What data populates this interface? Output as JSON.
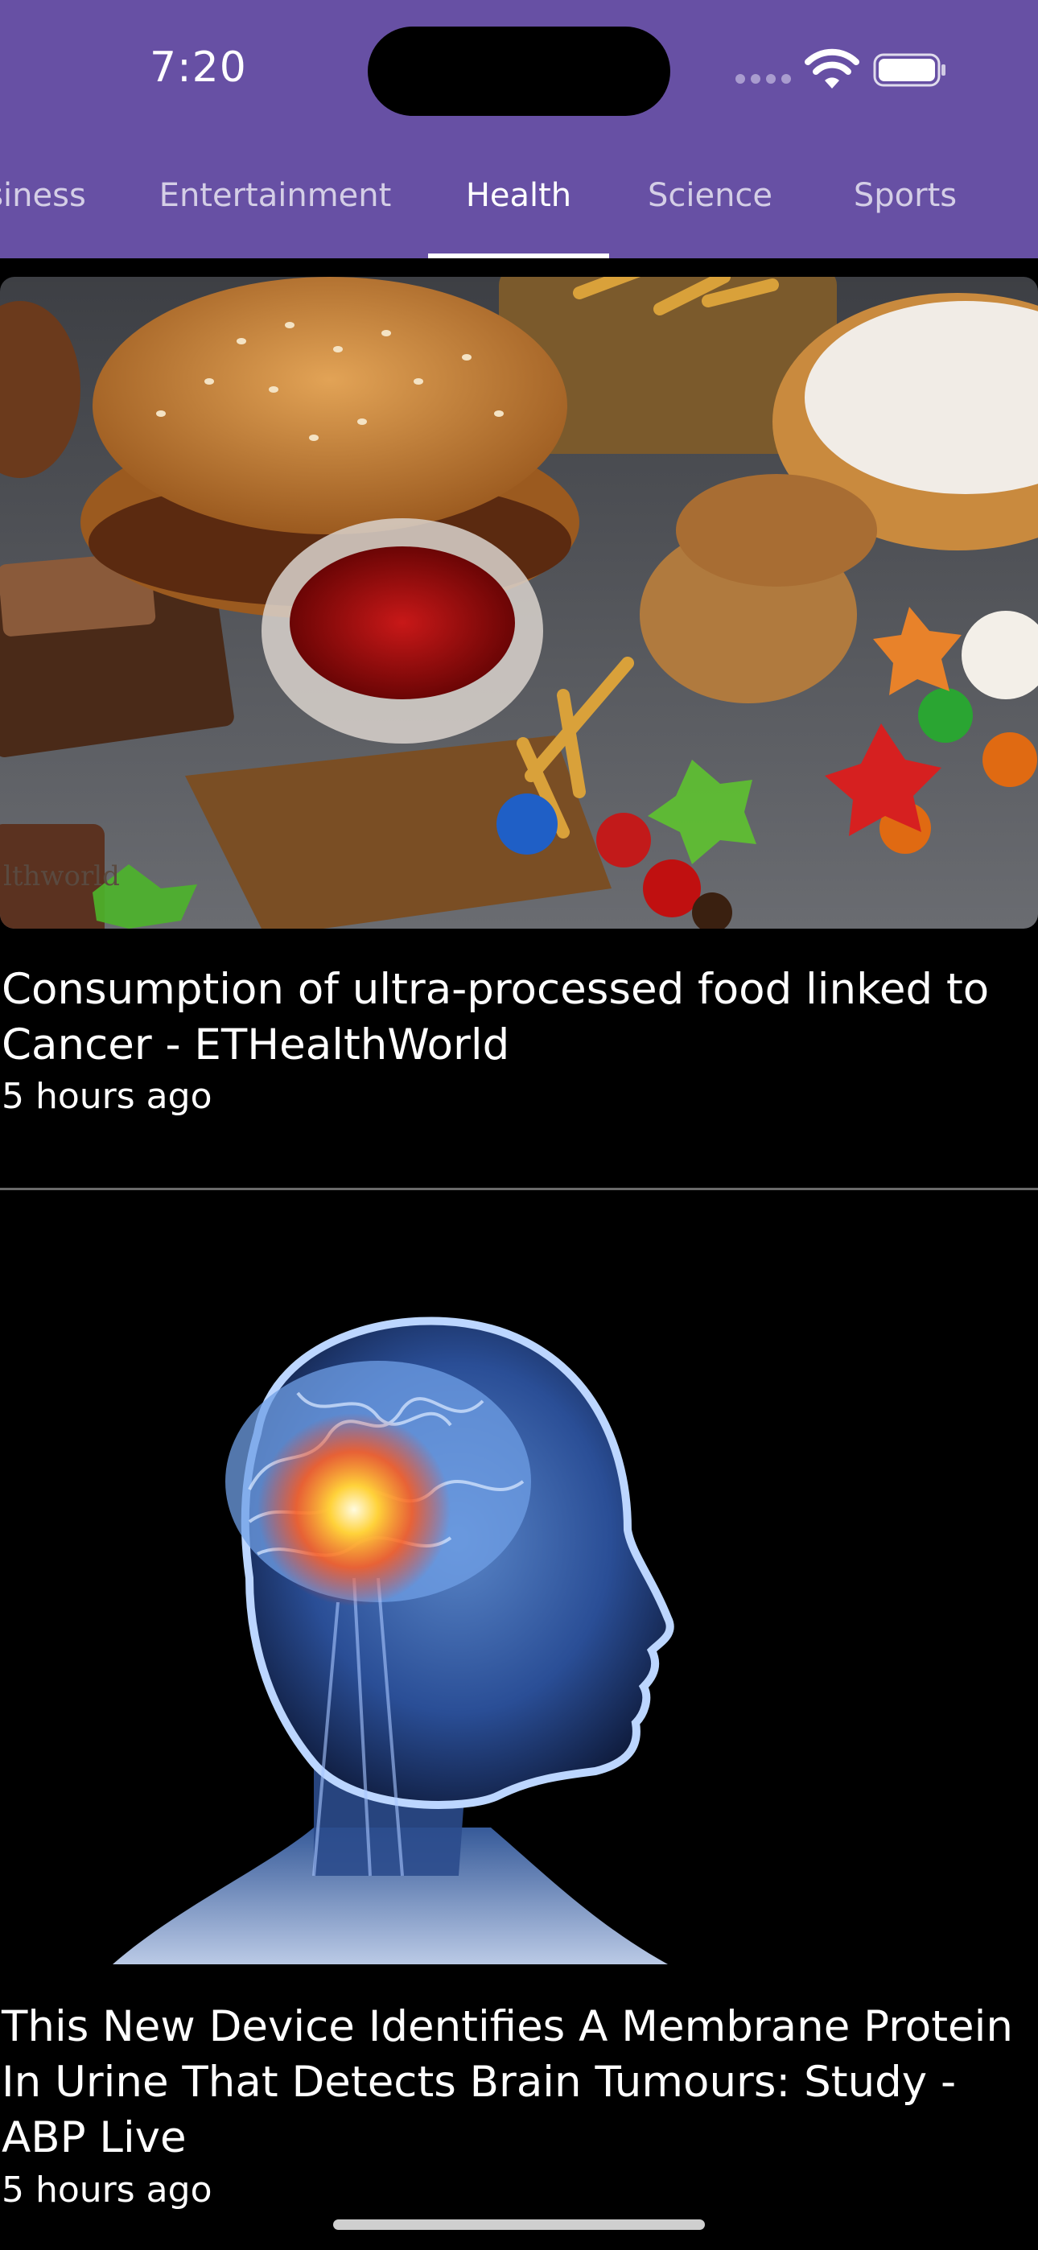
{
  "status_bar": {
    "time": "7:20"
  },
  "tabs": [
    {
      "label": "Business",
      "visible_label": "siness",
      "active": false
    },
    {
      "label": "Entertainment",
      "visible_label": "Entertainment",
      "active": false
    },
    {
      "label": "Health",
      "visible_label": "Health",
      "active": true
    },
    {
      "label": "Science",
      "visible_label": "Science",
      "active": false
    },
    {
      "label": "Sports",
      "visible_label": "Sports",
      "active": false
    }
  ],
  "articles": [
    {
      "title": "Consumption of ultra-processed food linked to Cancer - ETHealthWorld",
      "time": "5 hours ago",
      "image_watermark": "lthworld"
    },
    {
      "title": "This New Device Identifies A Membrane Protein In Urine That Detects Brain Tumours: Study - ABP Live",
      "time": "5 hours ago"
    }
  ],
  "colors": {
    "app_bar": "#6750A4",
    "background": "#000000",
    "text": "#FFFFFF"
  },
  "icons": [
    "cellular-signal-icon",
    "wifi-icon",
    "battery-icon"
  ]
}
